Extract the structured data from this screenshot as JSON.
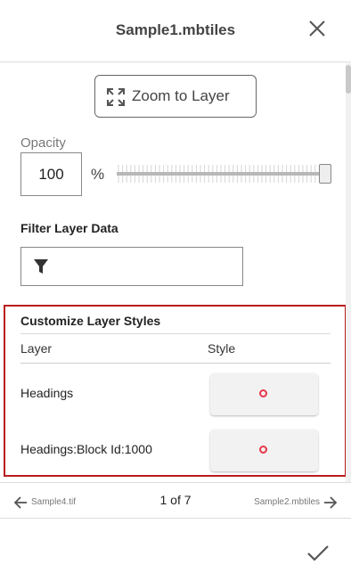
{
  "header": {
    "title": "Sample1.mbtiles",
    "close_icon": "close-icon"
  },
  "zoom": {
    "label": "Zoom to Layer",
    "icon": "zoom-extent-icon"
  },
  "opacity": {
    "label": "Opacity",
    "value": "100",
    "unit": "%",
    "slider_level": 1.0
  },
  "filter": {
    "label": "Filter Layer Data",
    "value": "",
    "icon": "filter-icon"
  },
  "styles": {
    "title": "Customize Layer Styles",
    "columns": {
      "layer": "Layer",
      "style": "Style"
    },
    "rows": [
      {
        "label": "Headings",
        "marker_color": "#e8364a"
      },
      {
        "label": "Headings:Block Id:1000",
        "marker_color": "#e8364a"
      }
    ],
    "highlight_color": "#b91c1c"
  },
  "nav": {
    "prev_label": "Sample4.tif",
    "page": "1 of 7",
    "next_label": "Sample2.mbtiles"
  },
  "confirm": {
    "icon": "checkmark-icon"
  }
}
